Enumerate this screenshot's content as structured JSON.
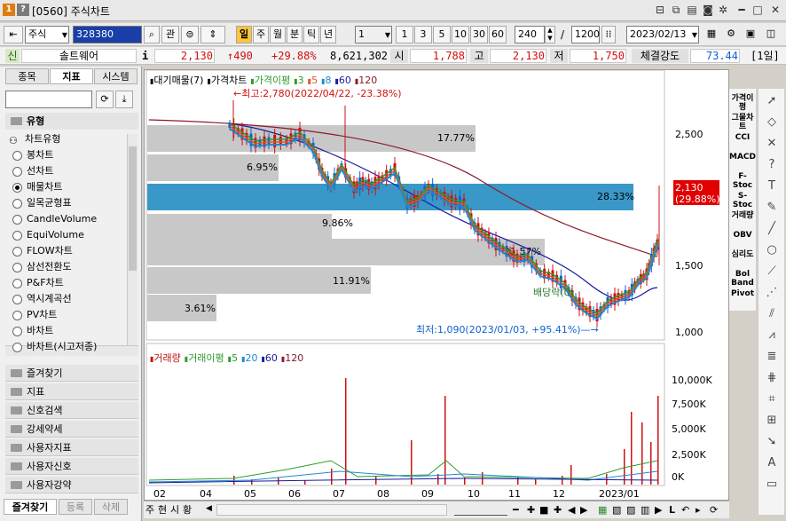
{
  "window": {
    "badge1": "1",
    "badge2": "?",
    "title": "[0560] 주식차트"
  },
  "toolbar": {
    "market": "주식",
    "code": "328380",
    "btn_gwan": "관",
    "periods": [
      "일",
      "주",
      "월",
      "분",
      "틱",
      "년"
    ],
    "period_active": "일",
    "interval_select": "1",
    "intervals": [
      "1",
      "3",
      "5",
      "10",
      "30",
      "60"
    ],
    "count": "240",
    "slash": "/",
    "total": "1200",
    "date": "2023/02/13"
  },
  "quote": {
    "badge": "신",
    "name": "솔트웨어",
    "info_icon": "i",
    "price": "2,130",
    "change": "↑490",
    "change_pct": "+29.88%",
    "volume": "8,621,302",
    "open_label": "시",
    "open": "1,788",
    "high_label": "고",
    "high": "2,130",
    "low_label": "저",
    "low": "1,750",
    "strength_label": "체결강도",
    "strength": "73.44",
    "period_label": "[1일]"
  },
  "leftpanel": {
    "tabs": [
      "종목",
      "지표",
      "시스템"
    ],
    "active_tab": "지표",
    "section": "유형",
    "group": "차트유형",
    "items": [
      "봉차트",
      "선차트",
      "매물차트",
      "일목균형표",
      "CandleVolume",
      "EquiVolume",
      "FLOW차트",
      "삼선전환도",
      "P&F차트",
      "역시계곡선",
      "PV차트",
      "바차트",
      "바차트(시고저종)"
    ],
    "selected_item": "매물차트",
    "folders": [
      "즐겨찾기",
      "지표",
      "신호검색",
      "강세약세",
      "사용자지표",
      "사용자신호",
      "사용자강약"
    ],
    "bottom_tabs": [
      "즐겨찾기",
      "등록",
      "삭제"
    ]
  },
  "price_panel": {
    "legend": [
      {
        "text": "대기매물(7)",
        "color": "#000000"
      },
      {
        "text": "가격차트",
        "color": "#000000"
      },
      {
        "text": "가격이평",
        "color": "#2e9b2e"
      },
      {
        "text": "3",
        "color": "#2e9b2e"
      },
      {
        "text": "5",
        "color": "#e0572b"
      },
      {
        "text": "8",
        "color": "#1e8ad0"
      },
      {
        "text": "60",
        "color": "#1a1aa0"
      },
      {
        "text": "120",
        "color": "#8a1a2a"
      }
    ],
    "high_annotation": "최고:2,780(2022/04/22, -23.38%)",
    "low_annotation": "최저:1,090(2023/01/03, +95.41%)",
    "dividend_label": "배당락(0)",
    "volume_profile_labels": [
      "17.77%",
      "6.95%",
      "28.33%",
      "9.86%",
      "21.57%",
      "11.91%",
      "3.61%"
    ],
    "y_ticks": [
      "2,500",
      "2,000",
      "1,500",
      "1,000"
    ],
    "current_price": "2,130",
    "current_pct": "(29.88%)"
  },
  "volume_panel": {
    "legend": [
      {
        "text": "거래량",
        "color": "#c01010"
      },
      {
        "text": "거래이평",
        "color": "#2e9b2e"
      },
      {
        "text": "5",
        "color": "#2e9b2e"
      },
      {
        "text": "20",
        "color": "#1e8ad0"
      },
      {
        "text": "60",
        "color": "#1a1aa0"
      },
      {
        "text": "120",
        "color": "#8a1a2a"
      }
    ],
    "y_ticks": [
      "10,000K",
      "7,500K",
      "5,000K",
      "2,500K",
      "0K"
    ]
  },
  "x_ticks": [
    "02",
    "04",
    "05",
    "06",
    "07",
    "08",
    "09",
    "10",
    "11",
    "12",
    "2023/01"
  ],
  "right_tools": [
    "가격이평",
    "그물차트",
    "CCI",
    "MACD",
    "F-Stoc",
    "S-Stoc",
    "거래량",
    "OBV",
    "심리도",
    "Bol Band",
    "Pivot"
  ],
  "bottom_bar": {
    "tabs": [
      "주",
      "현",
      "시",
      "황"
    ]
  },
  "colors": {
    "profile_gray": "#c8c8c8",
    "profile_blue": "#3a98c8",
    "up": "#d01010",
    "down": "#1060d0",
    "ma5": "#2e9b2e",
    "ma8": "#e0572b",
    "ma20": "#1e8ad0",
    "ma60": "#1a1aa0",
    "ma120": "#8a1a2a",
    "current_tag": "#e00000"
  }
}
